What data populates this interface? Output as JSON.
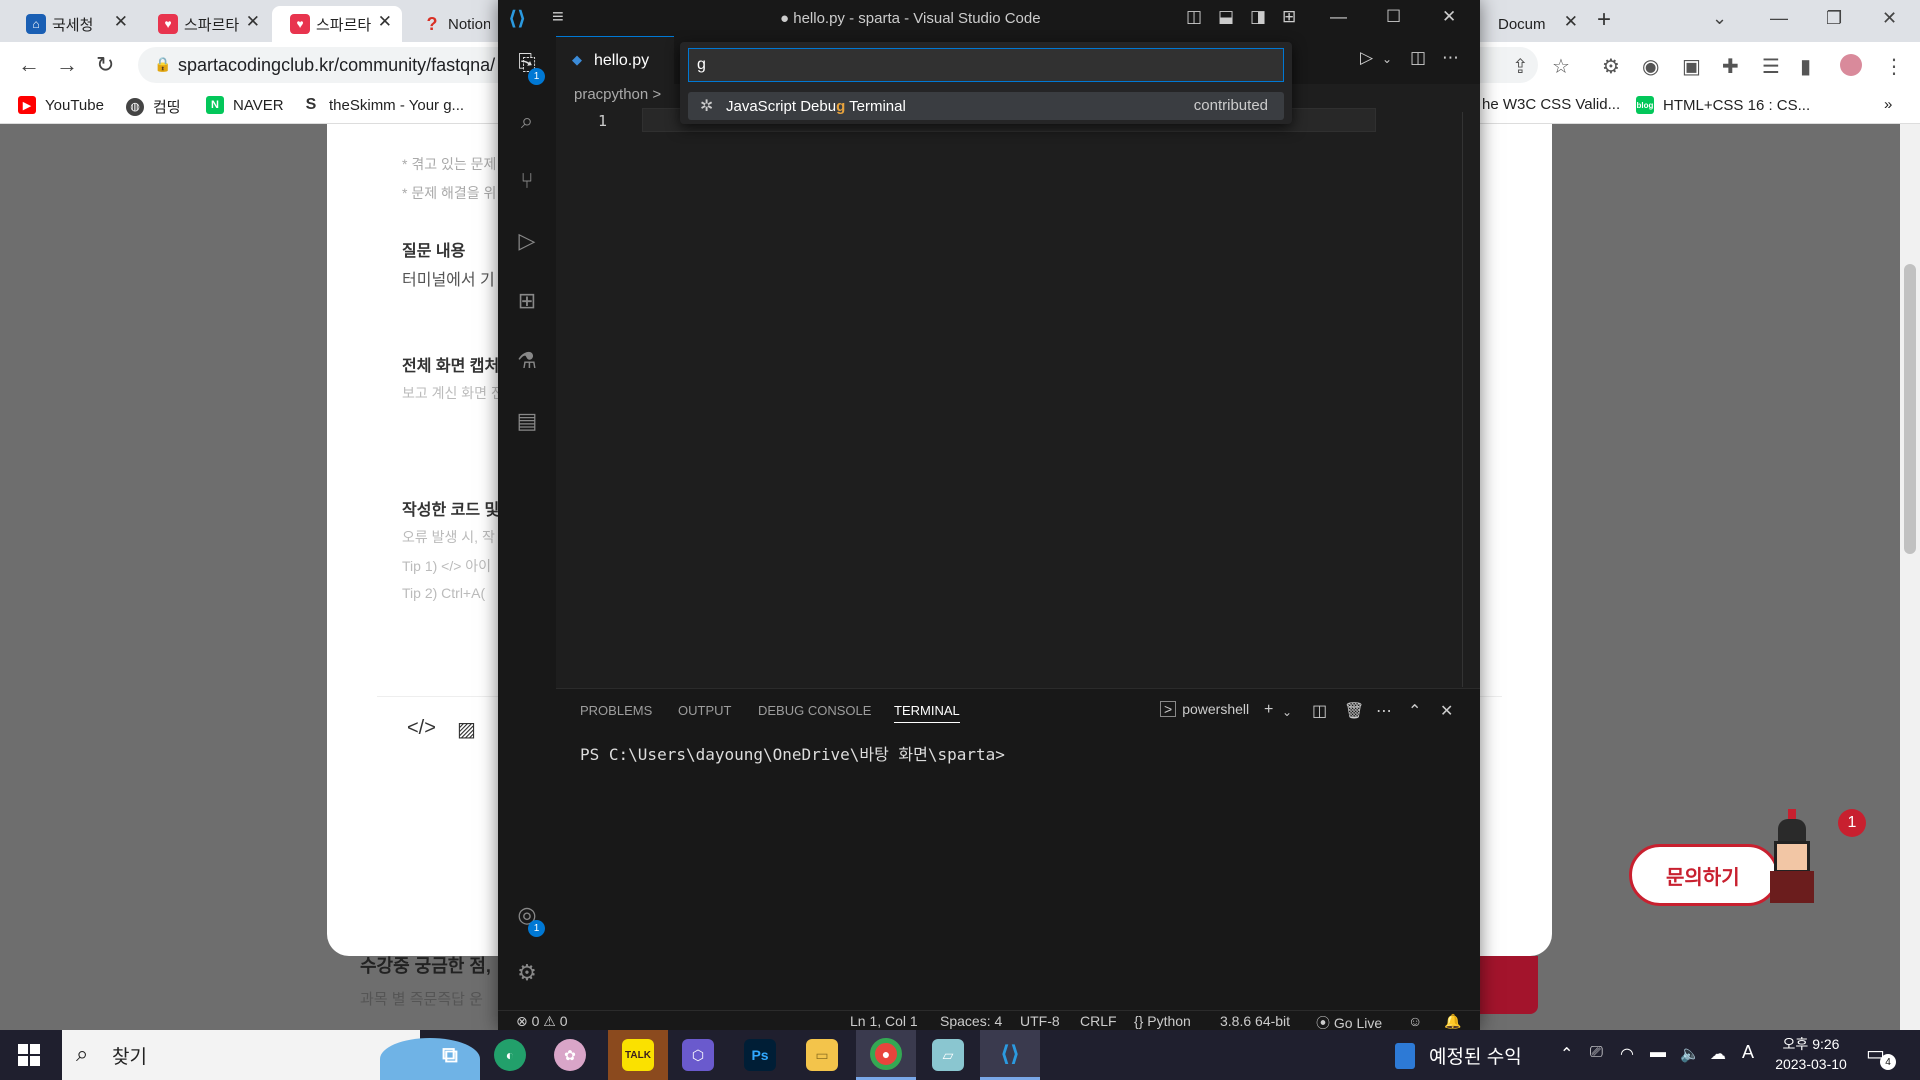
{
  "browser": {
    "tabs": [
      {
        "title": "국세청",
        "fav": "hometax",
        "color": "#1a5fb4"
      },
      {
        "title": "스파르타",
        "fav": "♥",
        "color": "#e8344e"
      },
      {
        "title": "스파르타",
        "fav": "♥",
        "color": "#e8344e"
      },
      {
        "title": "Notion",
        "fav": "?",
        "color": "#d93025"
      },
      {
        "title": "Docum",
        "fav": "◐",
        "color": "#666666"
      }
    ],
    "url": "spartacodingclub.kr/community/fastqna/",
    "bookmarks": [
      {
        "label": "YouTube",
        "icon": "▶",
        "color": "#ff0000"
      },
      {
        "label": "컴띵",
        "icon": "◍",
        "color": "#444444"
      },
      {
        "label": "NAVER",
        "icon": "N",
        "color": "#03c75a"
      },
      {
        "label": "theSkimm - Your g...",
        "icon": "S",
        "color": "#333333"
      },
      {
        "label": "he W3C CSS Valid...",
        "icon": "",
        "color": "#ffffff"
      },
      {
        "label": "HTML+CSS 16 : CS...",
        "icon": "blog",
        "color": "#03c75a"
      }
    ]
  },
  "webpage": {
    "notes": [
      "* 겪고 있는 문제",
      "* 문제 해결을 위"
    ],
    "question_heading": "질문 내용",
    "question_text": "터미널에서 기",
    "capture_heading": "전체 화면 캡처",
    "capture_hint": "보고 계신 화면 전",
    "code_heading": "작성한 코드 및",
    "code_hints": [
      "오류 발생 시, 작",
      "Tip 1) </> 아이",
      "Tip 2) Ctrl+A("
    ],
    "footer_title": "수강중 궁금한 점,",
    "footer_sub": "과목 별 즉문즉답 운",
    "inquiry_button": "문의하기",
    "notification_count": "1"
  },
  "vscode": {
    "window_title": "● hello.py - sparta - Visual Studio Code",
    "tab_label": "hello.py",
    "breadcrumb": "pracpython >",
    "line_number": "1",
    "explorer_badge": "1",
    "accounts_badge": "1",
    "palette": {
      "query": "g",
      "result_before": "JavaScript Debu",
      "result_match": "g",
      "result_after": " Terminal",
      "result_tag": "contributed"
    },
    "panel_tabs": [
      "PROBLEMS",
      "OUTPUT",
      "DEBUG CONSOLE",
      "TERMINAL"
    ],
    "terminal_shell": "powershell",
    "terminal_prompt": "PS C:\\Users\\dayoung\\OneDrive\\바탕 화면\\sparta>",
    "status": {
      "problems": "⊗ 0 ⚠ 0",
      "position": "Ln 1, Col 1",
      "spaces": "Spaces: 4",
      "encoding": "UTF-8",
      "eol": "CRLF",
      "language": "Python",
      "interpreter": "3.8.6 64-bit",
      "golive": "Go Live"
    }
  },
  "taskbar": {
    "search_placeholder": "찾기",
    "news": "예정된 수익",
    "time": "오후 9:26",
    "date": "2023-03-10",
    "ime": "A",
    "notification_count": "4"
  }
}
